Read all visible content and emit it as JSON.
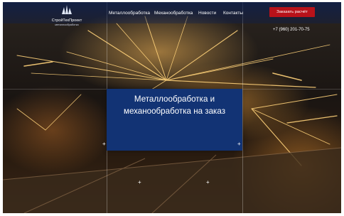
{
  "header": {
    "logo": {
      "name": "СтройТехПроект",
      "tagline": "металлообработка"
    },
    "nav": [
      {
        "label": "Металлообработка"
      },
      {
        "label": "Механообработка"
      },
      {
        "label": "Новости"
      },
      {
        "label": "Контакты"
      }
    ],
    "cta_label": "Заказать расчёт",
    "phone": "+7 (960) 201-70-75"
  },
  "hero": {
    "title_line1": "Металлообработка и",
    "title_line2": "механообработка на заказ"
  },
  "markers": {
    "plus_symbol": "+"
  },
  "colors": {
    "header_overlay": "#0a1e50",
    "cta_background": "#b8121a",
    "hero_box": "#123374",
    "spark": "#ffd27a"
  }
}
